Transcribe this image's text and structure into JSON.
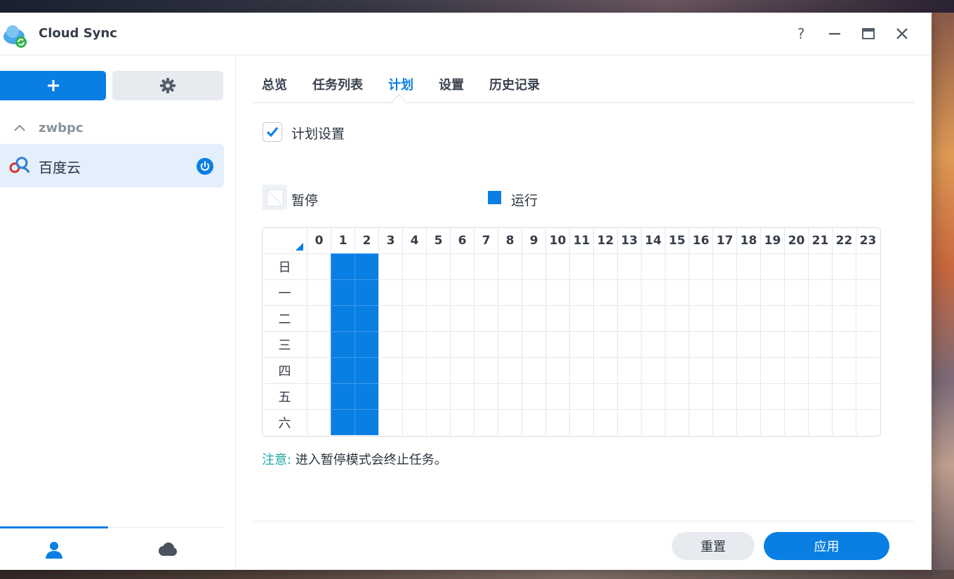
{
  "window": {
    "title": "Cloud Sync",
    "controls": {
      "help": "?",
      "minimize": "—",
      "maximize": "▭",
      "close": "✕"
    }
  },
  "sidebar": {
    "add_label": "+",
    "group_label": "zwbpc",
    "connection_label": "百度云"
  },
  "tabs": [
    {
      "label": "总览"
    },
    {
      "label": "任务列表"
    },
    {
      "label": "计划"
    },
    {
      "label": "设置"
    },
    {
      "label": "历史记录"
    }
  ],
  "active_tab": "计划",
  "schedule": {
    "checkbox_label": "计划设置",
    "checked": true,
    "legend_pause": "暂停",
    "legend_run": "运行",
    "hours": [
      "0",
      "1",
      "2",
      "3",
      "4",
      "5",
      "6",
      "7",
      "8",
      "9",
      "10",
      "11",
      "12",
      "13",
      "14",
      "15",
      "16",
      "17",
      "18",
      "19",
      "20",
      "21",
      "22",
      "23"
    ],
    "days": [
      "日",
      "一",
      "二",
      "三",
      "四",
      "五",
      "六"
    ],
    "run_hours": [
      1,
      2
    ]
  },
  "note": {
    "label": "注意:",
    "text": " 进入暂停模式会终止任务。"
  },
  "footer": {
    "reset_label": "重置",
    "apply_label": "应用"
  },
  "colors": {
    "accent": "#0a7fe3",
    "note": "#1aa6a6"
  }
}
